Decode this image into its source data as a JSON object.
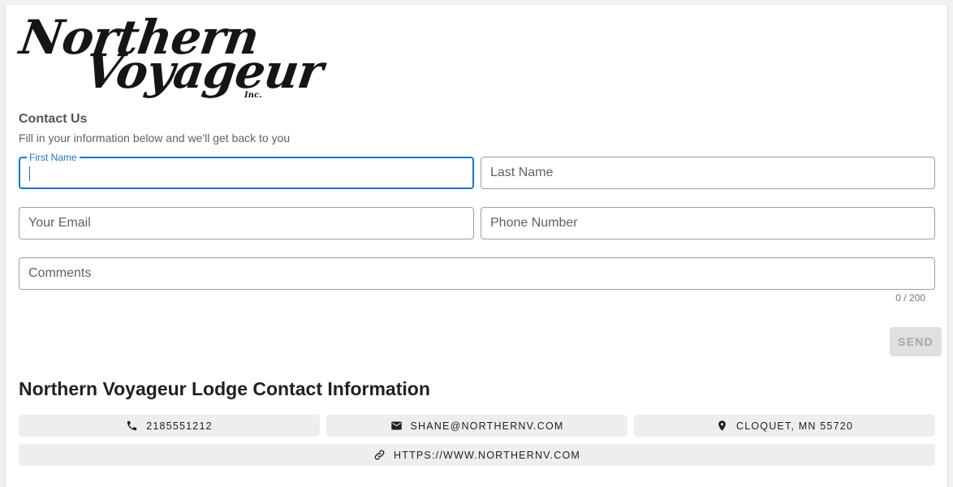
{
  "logo": {
    "line1": "Northern",
    "line2": "Voyageur",
    "suffix": "Inc."
  },
  "form": {
    "title": "Contact Us",
    "subtitle": "Fill in your information below and we'll get back to you",
    "fields": {
      "first_name": {
        "label": "First Name",
        "value": ""
      },
      "last_name": {
        "placeholder": "Last Name",
        "value": ""
      },
      "email": {
        "placeholder": "Your Email",
        "value": ""
      },
      "phone": {
        "placeholder": "Phone Number",
        "value": ""
      },
      "comments": {
        "placeholder": "Comments",
        "value": ""
      }
    },
    "counter": "0 / 200",
    "send_label": "SEND"
  },
  "contact": {
    "title": "Northern Voyageur Lodge Contact Information",
    "phone": "2185551212",
    "email": "SHANE@NORTHERNV.COM",
    "location": "CLOQUET, MN 55720",
    "website": "HTTPS://WWW.NORTHERNV.COM"
  },
  "colors": {
    "accent": "#1976d2",
    "disabled_button": "#e0e0e0",
    "chip_background": "#eeeeee"
  },
  "icons": {
    "phone": "phone-icon",
    "email": "email-icon",
    "location": "location-pin-icon",
    "website": "link-icon"
  }
}
